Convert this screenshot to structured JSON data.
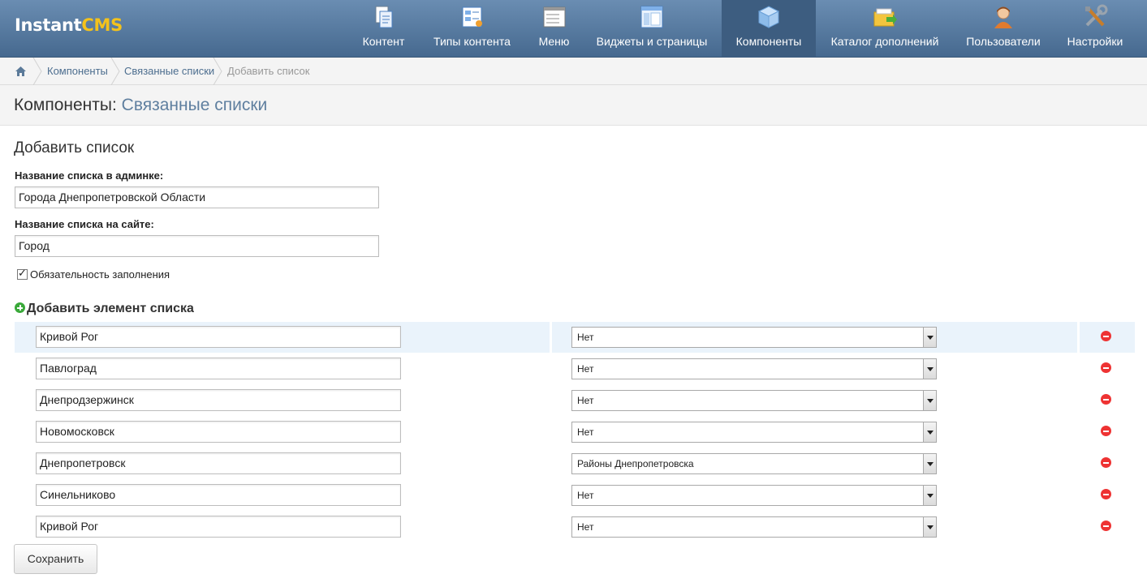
{
  "app": {
    "logo_part1": "Instant",
    "logo_part2": "CMS"
  },
  "nav": [
    {
      "label": "Контент",
      "icon": "content-icon"
    },
    {
      "label": "Типы контента",
      "icon": "content-types-icon"
    },
    {
      "label": "Меню",
      "icon": "menu-icon"
    },
    {
      "label": "Виджеты и страницы",
      "icon": "widgets-icon"
    },
    {
      "label": "Компоненты",
      "icon": "components-icon",
      "active": true
    },
    {
      "label": "Каталог дополнений",
      "icon": "addons-catalog-icon"
    },
    {
      "label": "Пользователи",
      "icon": "users-icon"
    },
    {
      "label": "Настройки",
      "icon": "settings-icon"
    }
  ],
  "breadcrumb": [
    "Компоненты",
    "Связанные списки",
    "Добавить список"
  ],
  "header": {
    "title": "Компоненты:",
    "subtitle": "Связанные списки"
  },
  "form": {
    "title": "Добавить список",
    "admin_name_label": "Название списка в админке:",
    "admin_name_value": "Города Днепропетровской Области",
    "site_name_label": "Название списка на сайте:",
    "site_name_value": "Город",
    "required_label": "Обязательность заполнения",
    "required_checked": true,
    "add_item_label": "Добавить элемент списка",
    "items": [
      {
        "name": "Кривой Рог",
        "link": "Нет"
      },
      {
        "name": "Павлоград",
        "link": "Нет"
      },
      {
        "name": "Днепродзержинск",
        "link": "Нет"
      },
      {
        "name": "Новомосковск",
        "link": "Нет"
      },
      {
        "name": "Днепропетровск",
        "link": "Районы Днепропетровска"
      },
      {
        "name": "Синельниково",
        "link": "Нет"
      },
      {
        "name": "Кривой Рог",
        "link": "Нет"
      }
    ],
    "save_label": "Сохранить"
  },
  "colors": {
    "topbar": "#46698f",
    "accent_logo": "#f4c21b",
    "add_icon": "#3aa93a",
    "remove_icon": "#ee3333"
  }
}
